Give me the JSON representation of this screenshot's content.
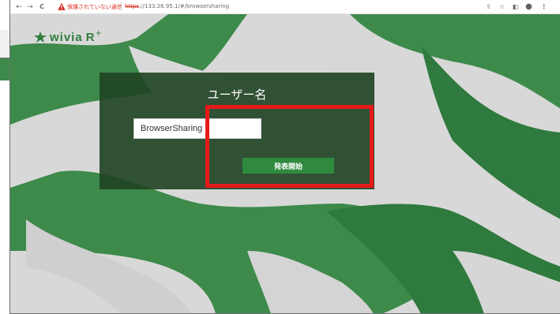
{
  "browser": {
    "back_icon": "←",
    "forward_icon": "→",
    "reload_icon": "C",
    "warning_icon": "warning-triangle",
    "security_warning": "保護されていない通信",
    "url_scheme": "https",
    "url_rest": "://133.26.95.1/#/browsersharing",
    "toolbar_icons": [
      "share-icon",
      "star-icon",
      "sidebar-icon",
      "profile-icon",
      "menu-icon"
    ],
    "share_glyph": "⇪",
    "star_glyph": "☆",
    "sidebar_glyph": "◧",
    "profile_glyph": "●",
    "menu_glyph": "⋮"
  },
  "app": {
    "logo": "wivia",
    "logo_suffix": "R",
    "logo_sup": "+",
    "logo_icon": "leaf-star-icon"
  },
  "form": {
    "title": "ユーザー名",
    "username_value": "BrowserSharing",
    "start_button": "発表開始"
  },
  "colors": {
    "brand_green": "#2e7d3c",
    "panel_green": "#1f4223",
    "button_green": "#2f8a3e",
    "highlight_red": "#e51a1a",
    "warning_red": "#d93025"
  }
}
